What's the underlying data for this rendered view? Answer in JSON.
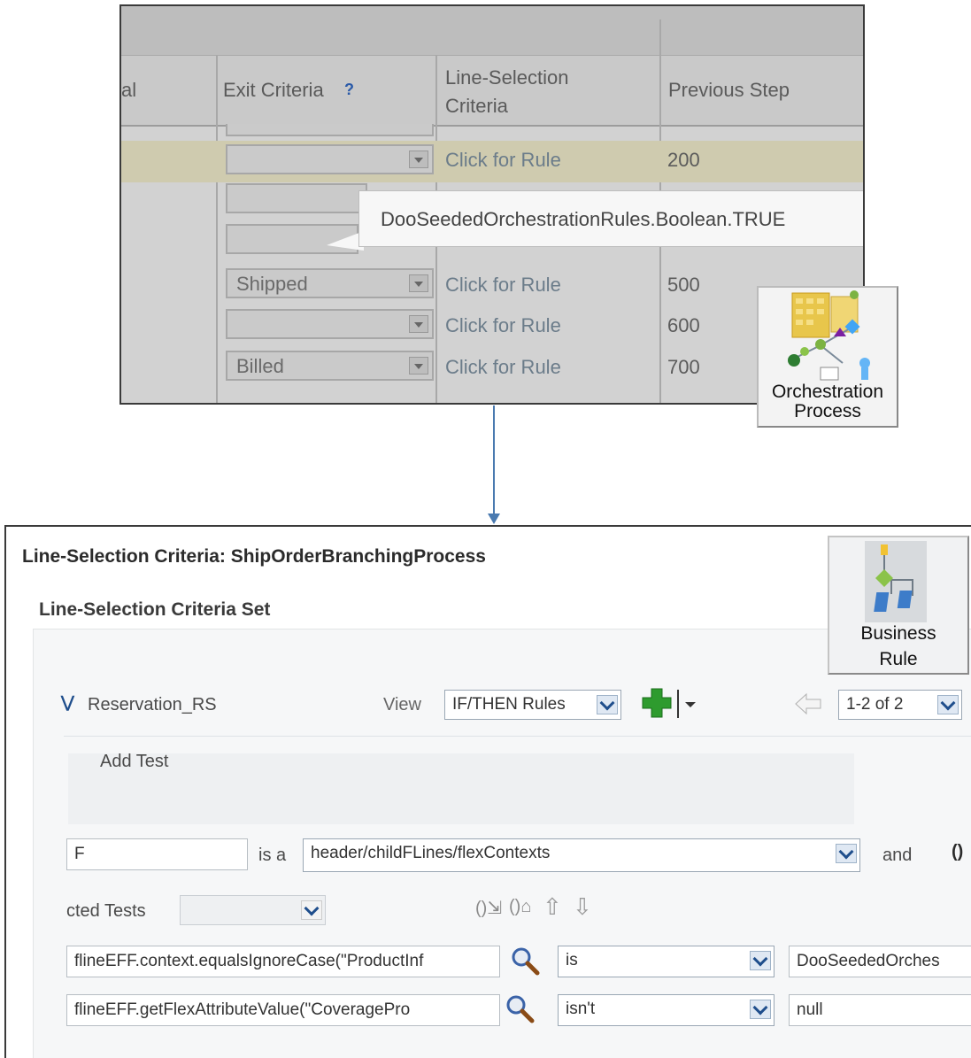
{
  "top": {
    "headers": {
      "partial": "al",
      "exit_criteria": "Exit Criteria",
      "help": "?",
      "line_selection": "Line-Selection Criteria",
      "previous_step": "Previous Step"
    },
    "rows": [
      {
        "exit": "",
        "rule": "Click for Rule",
        "prev": "200"
      },
      {
        "exit": "Shipped",
        "rule": "Click for Rule",
        "prev": "500"
      },
      {
        "exit": "",
        "rule": "Click for Rule",
        "prev": "600"
      },
      {
        "exit": "Billed",
        "rule": "Click for Rule",
        "prev": "700"
      }
    ],
    "tooltip": "DooSeededOrchestrationRules.Boolean.TRUE",
    "orchestration_icon_label_1": "Orchestration",
    "orchestration_icon_label_2": "Process"
  },
  "bottom": {
    "title": "Line-Selection Criteria: ShipOrderBranchingProcess",
    "set_title": "Line-Selection Criteria Set",
    "rule_set_name": "Reservation_RS",
    "view_label": "View",
    "view_value": "IF/THEN Rules",
    "pager": "1-2 of 2",
    "add_test": "Add Test",
    "alias_value": "F",
    "is_a": "is a",
    "fact_type": "header/childFLines/flexContexts",
    "and": "and",
    "paren_glyph": "()",
    "selected_tests_label": "cted Tests",
    "test1_left": "flineEFF.context.equalsIgnoreCase(\"ProductInf",
    "test1_op": "is",
    "test1_right": "DooSeededOrches",
    "test2_left": "flineEFF.getFlexAttributeValue(\"CoveragePro",
    "test2_op": "isn't",
    "test2_right": "null",
    "business_rule_label_1": "Business",
    "business_rule_label_2": "Rule"
  },
  "colors": {
    "accent_blue": "#4a7ab0",
    "add_green": "#2e9b2e",
    "dropdown_blue": "#1f4e8c"
  }
}
